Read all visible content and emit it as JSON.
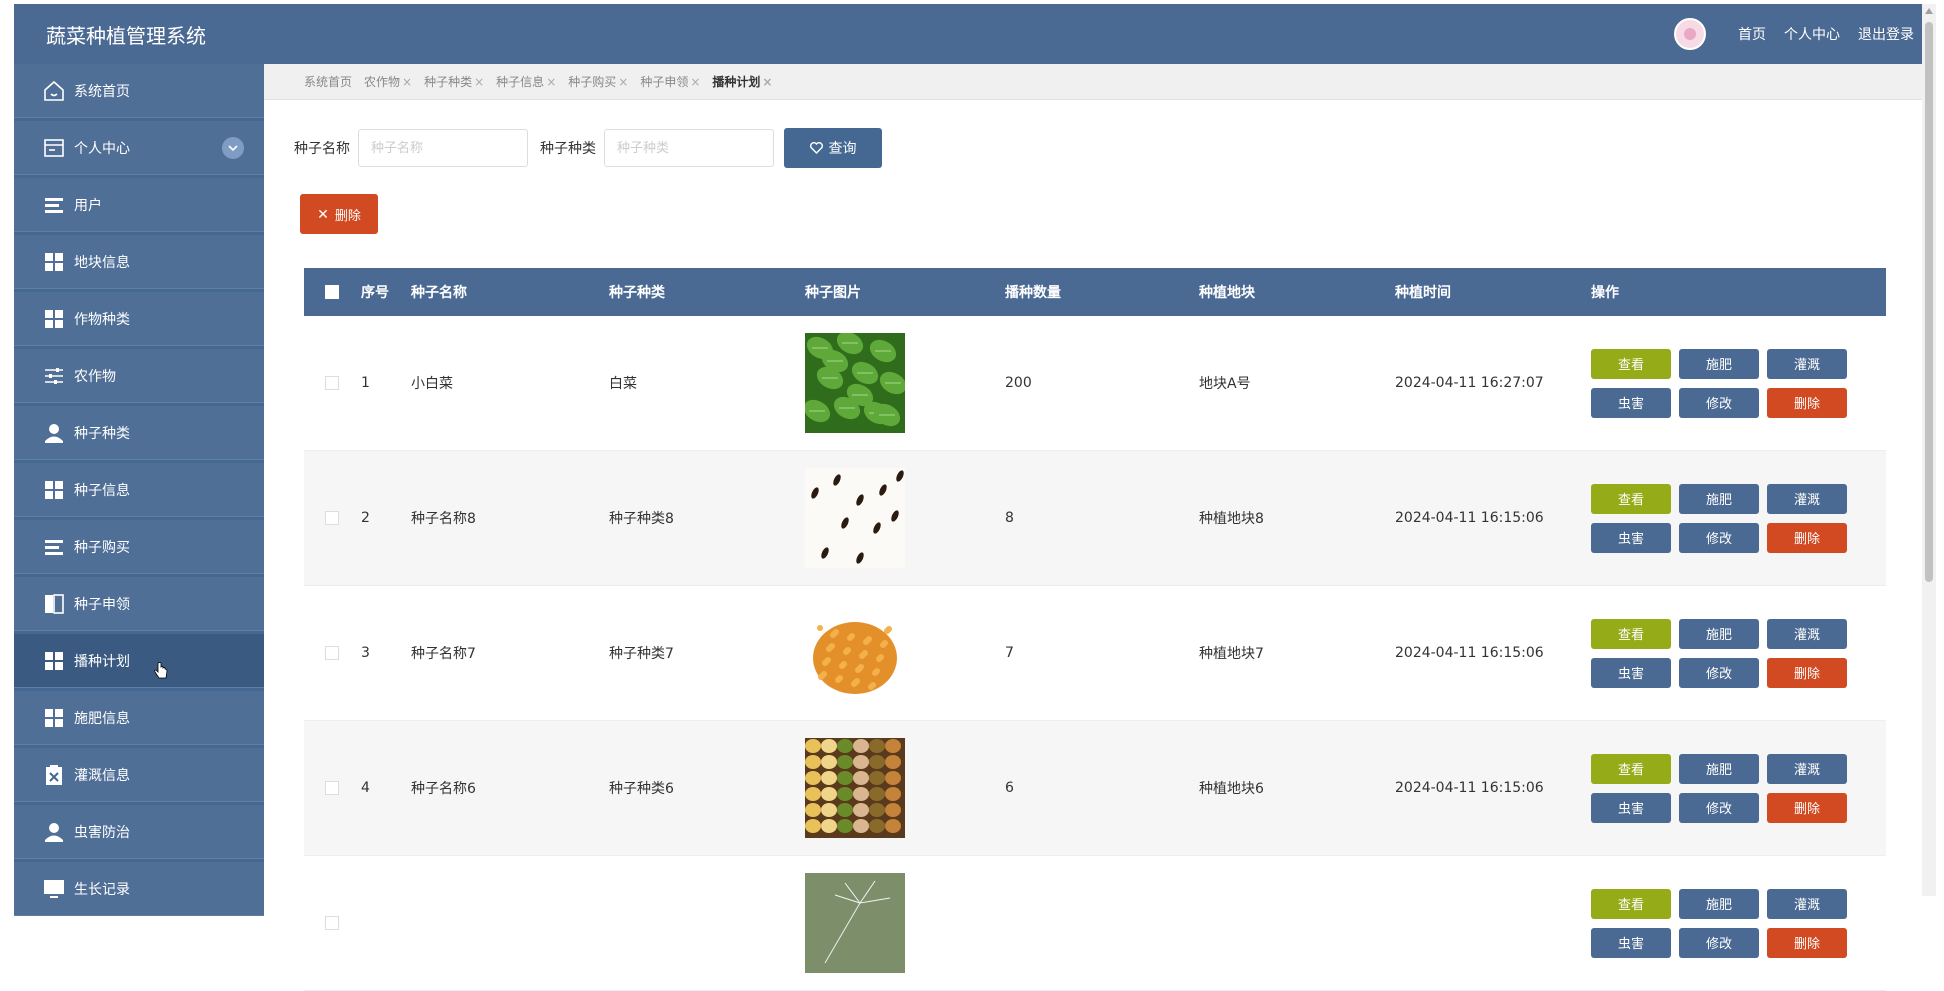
{
  "app": {
    "title": "蔬菜种植管理系统"
  },
  "topbar": {
    "links": [
      "首页",
      "个人中心",
      "退出登录"
    ]
  },
  "sidebar": {
    "items": [
      {
        "label": "系统首页",
        "icon": "home-icon"
      },
      {
        "label": "个人中心",
        "icon": "profile-icon",
        "expandable": true
      },
      {
        "label": "用户",
        "icon": "list-icon"
      },
      {
        "label": "地块信息",
        "icon": "grid-icon"
      },
      {
        "label": "作物种类",
        "icon": "grid-icon"
      },
      {
        "label": "农作物",
        "icon": "sliders-icon"
      },
      {
        "label": "种子种类",
        "icon": "user-icon"
      },
      {
        "label": "种子信息",
        "icon": "grid-icon"
      },
      {
        "label": "种子购买",
        "icon": "list-icon"
      },
      {
        "label": "种子申领",
        "icon": "book-icon"
      },
      {
        "label": "播种计划",
        "icon": "grid-icon",
        "active": true
      },
      {
        "label": "施肥信息",
        "icon": "grid-icon"
      },
      {
        "label": "灌溉信息",
        "icon": "clipboard-icon"
      },
      {
        "label": "虫害防治",
        "icon": "user-icon"
      },
      {
        "label": "生长记录",
        "icon": "monitor-icon"
      }
    ]
  },
  "tabs": [
    {
      "label": "系统首页",
      "closable": false
    },
    {
      "label": "农作物",
      "closable": true
    },
    {
      "label": "种子种类",
      "closable": true
    },
    {
      "label": "种子信息",
      "closable": true
    },
    {
      "label": "种子购买",
      "closable": true
    },
    {
      "label": "种子申领",
      "closable": true
    },
    {
      "label": "播种计划",
      "closable": true,
      "active": true
    }
  ],
  "search": {
    "name_label": "种子名称",
    "name_placeholder": "种子名称",
    "kind_label": "种子种类",
    "kind_placeholder": "种子种类",
    "query_label": "查询"
  },
  "toolbar": {
    "delete_label": "删除"
  },
  "table": {
    "headers": [
      "序号",
      "种子名称",
      "种子种类",
      "种子图片",
      "播种数量",
      "种植地块",
      "种植时间",
      "操作"
    ],
    "rows": [
      {
        "idx": "1",
        "name": "小白菜",
        "kind": "白菜",
        "image": "leafy-greens",
        "qty": "200",
        "plot": "地块A号",
        "time": "2024-04-11 16:27:07"
      },
      {
        "idx": "2",
        "name": "种子名称8",
        "kind": "种子种类8",
        "image": "scattered-seeds",
        "qty": "8",
        "plot": "种植地块8",
        "time": "2024-04-11 16:15:06"
      },
      {
        "idx": "3",
        "name": "种子名称7",
        "kind": "种子种类7",
        "image": "orange-seed-pile",
        "qty": "7",
        "plot": "种植地块7",
        "time": "2024-04-11 16:15:06"
      },
      {
        "idx": "4",
        "name": "种子名称6",
        "kind": "种子种类6",
        "image": "mixed-beans",
        "qty": "6",
        "plot": "种植地块6",
        "time": "2024-04-11 16:15:06"
      },
      {
        "idx": "",
        "name": "",
        "kind": "",
        "image": "dandelion-seed",
        "qty": "",
        "plot": "",
        "time": ""
      }
    ],
    "ops": [
      "查看",
      "施肥",
      "灌溉",
      "虫害",
      "修改",
      "删除"
    ]
  },
  "colors": {
    "primary": "#4b6a93",
    "sidebar": "#456892",
    "view": "#95ab18",
    "danger": "#d24a22"
  }
}
